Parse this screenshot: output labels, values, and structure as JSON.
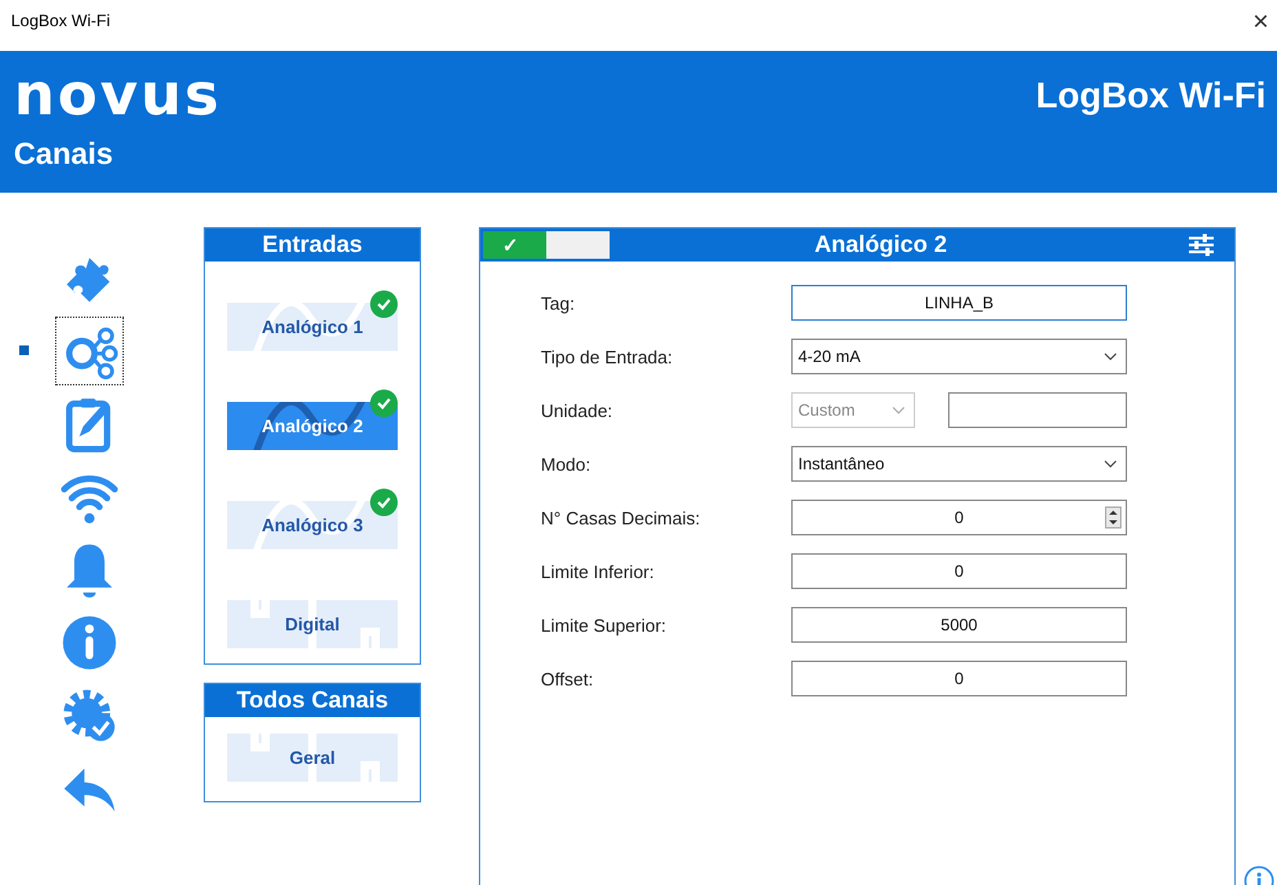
{
  "window": {
    "title": "LogBox Wi-Fi",
    "close": "×"
  },
  "header": {
    "logo": "novus",
    "product": "LogBox Wi-Fi",
    "section": "Canais"
  },
  "nav": [
    {
      "selected": false
    },
    {
      "selected": true
    },
    {
      "selected": false
    },
    {
      "selected": false
    },
    {
      "selected": false
    },
    {
      "selected": false
    },
    {
      "selected": false
    },
    {
      "selected": false
    }
  ],
  "inputs_panel": {
    "title": "Entradas",
    "items": [
      {
        "label": "Analógico 1",
        "selected": false,
        "checked": true,
        "kind": "analog"
      },
      {
        "label": "Analógico 2",
        "selected": true,
        "checked": true,
        "kind": "analog"
      },
      {
        "label": "Analógico 3",
        "selected": false,
        "checked": true,
        "kind": "analog"
      },
      {
        "label": "Digital",
        "selected": false,
        "checked": false,
        "kind": "digital"
      }
    ]
  },
  "all_channels_panel": {
    "title": "Todos Canais",
    "items": [
      {
        "label": "Geral",
        "selected": false,
        "checked": false,
        "kind": "digital"
      }
    ]
  },
  "channel_panel": {
    "title": "Analógico 2",
    "enabled": true,
    "check": "✓",
    "fields": [
      {
        "label": "Tag:",
        "kind": "text",
        "value": "LINHA_B",
        "focused": true
      },
      {
        "label": "Tipo de Entrada:",
        "kind": "select",
        "value": "4-20 mA",
        "focused": false
      },
      {
        "label": "Unidade:",
        "kind": "unit",
        "value": "Custom",
        "disabled": true,
        "focused": false
      },
      {
        "label": "Modo:",
        "kind": "select",
        "value": "Instantâneo",
        "focused": false
      },
      {
        "label": "N° Casas Decimais:",
        "kind": "spin",
        "value": "0",
        "focused": false
      },
      {
        "label": "Limite Inferior:",
        "kind": "text",
        "value": "0",
        "focused": false
      },
      {
        "label": "Limite Superior:",
        "kind": "text",
        "value": "5000",
        "focused": false
      },
      {
        "label": "Offset:",
        "kind": "text",
        "value": "0",
        "focused": false
      }
    ]
  }
}
